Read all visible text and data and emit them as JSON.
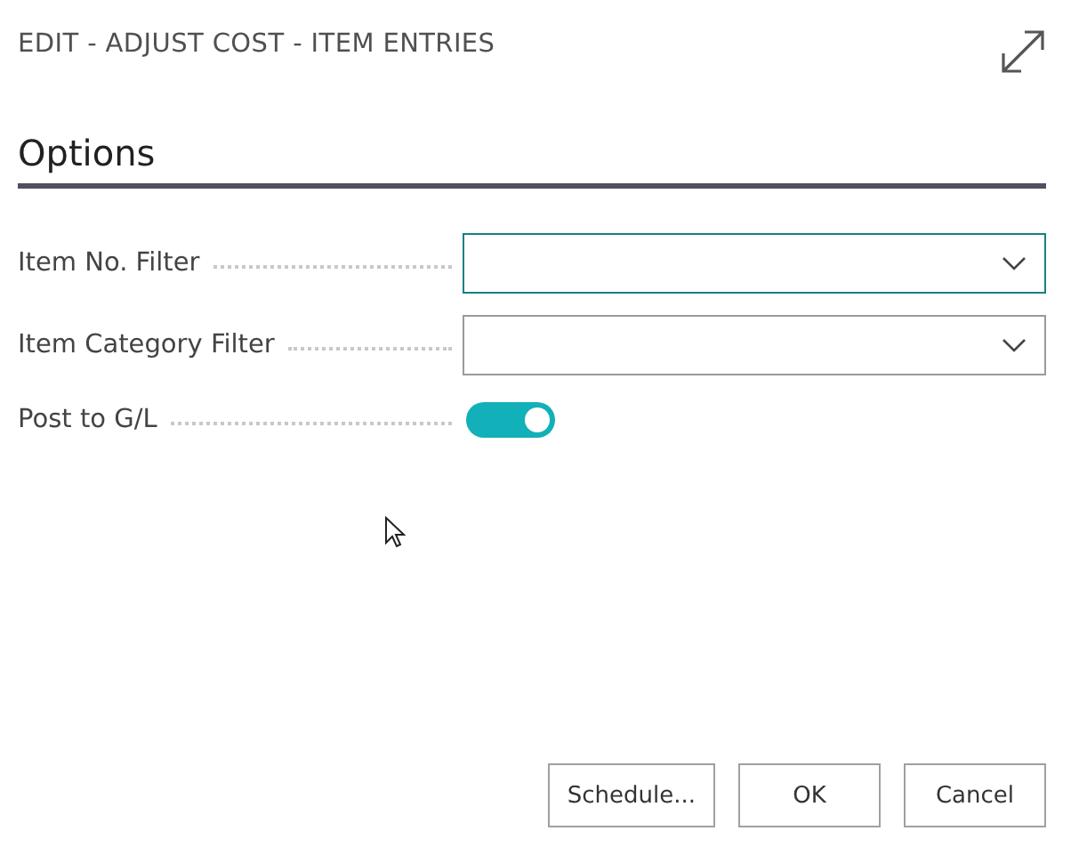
{
  "window": {
    "title": "EDIT - ADJUST COST - ITEM ENTRIES"
  },
  "section": {
    "title": "Options"
  },
  "fields": [
    {
      "kind": "dropdown",
      "label": "Item No. Filter",
      "focused": true
    },
    {
      "kind": "dropdown",
      "label": "Item Category Filter",
      "focused": false
    },
    {
      "kind": "toggle",
      "label": "Post to G/L",
      "on": true
    }
  ],
  "buttons": [
    "Schedule...",
    "OK",
    "Cancel"
  ]
}
